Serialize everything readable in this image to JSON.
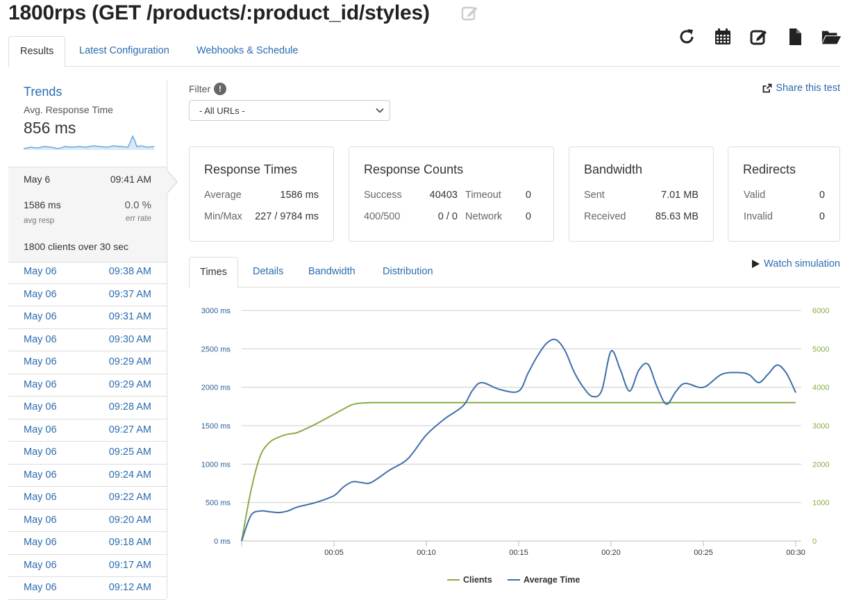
{
  "page": {
    "title": "1800rps (GET /products/:product_id/styles)"
  },
  "toolbar": {
    "icons": [
      "refresh-icon",
      "calendar-icon",
      "edit-icon",
      "file-icon",
      "folder-open-icon"
    ]
  },
  "top_tabs": [
    {
      "label": "Results",
      "active": true
    },
    {
      "label": "Latest Configuration",
      "active": false
    },
    {
      "label": "Webhooks & Schedule",
      "active": false
    }
  ],
  "trends": {
    "title": "Trends",
    "subtitle": "Avg. Response Time",
    "value": "856 ms"
  },
  "current_run": {
    "date": "May 6",
    "time": "09:41 AM",
    "avg_resp": "1586 ms",
    "avg_resp_label": "avg resp",
    "err_rate": "0.0 %",
    "err_rate_label": "err rate",
    "clients_text_a": "1800",
    "clients_text_b": " clients over ",
    "clients_text_c": "30",
    "clients_text_d": " sec"
  },
  "history": [
    {
      "date": "May 06",
      "time": "09:38 AM"
    },
    {
      "date": "May 06",
      "time": "09:37 AM"
    },
    {
      "date": "May 06",
      "time": "09:31 AM"
    },
    {
      "date": "May 06",
      "time": "09:30 AM"
    },
    {
      "date": "May 06",
      "time": "09:29 AM"
    },
    {
      "date": "May 06",
      "time": "09:29 AM"
    },
    {
      "date": "May 06",
      "time": "09:28 AM"
    },
    {
      "date": "May 06",
      "time": "09:27 AM"
    },
    {
      "date": "May 06",
      "time": "09:25 AM"
    },
    {
      "date": "May 06",
      "time": "09:24 AM"
    },
    {
      "date": "May 06",
      "time": "09:22 AM"
    },
    {
      "date": "May 06",
      "time": "09:20 AM"
    },
    {
      "date": "May 06",
      "time": "09:18 AM"
    },
    {
      "date": "May 06",
      "time": "09:17 AM"
    },
    {
      "date": "May 06",
      "time": "09:12 AM"
    }
  ],
  "filter": {
    "label": "Filter",
    "info": "!",
    "selected": "- All URLs -"
  },
  "share_label": "Share this test",
  "cards": {
    "response_times": {
      "title": "Response Times",
      "average_label": "Average",
      "average": "1586 ms",
      "minmax_label": "Min/Max",
      "minmax": "227 / 9784 ms"
    },
    "response_counts": {
      "title": "Response Counts",
      "success_label": "Success",
      "success": "40403",
      "timeout_label": "Timeout",
      "timeout": "0",
      "errors_label": "400/500",
      "errors": "0 / 0",
      "network_label": "Network",
      "network": "0"
    },
    "bandwidth": {
      "title": "Bandwidth",
      "sent_label": "Sent",
      "sent": "7.01 MB",
      "received_label": "Received",
      "received": "85.63 MB"
    },
    "redirects": {
      "title": "Redirects",
      "valid_label": "Valid",
      "valid": "0",
      "invalid_label": "Invalid",
      "invalid": "0"
    }
  },
  "chart_tabs": [
    {
      "label": "Times",
      "active": true
    },
    {
      "label": "Details",
      "active": false
    },
    {
      "label": "Bandwidth",
      "active": false
    },
    {
      "label": "Distribution",
      "active": false
    }
  ],
  "watch_label": "Watch simulation",
  "colors": {
    "clients": "#8aab45",
    "avg_time": "#3e6ea8",
    "link": "#2a6cb0",
    "spark": "#6aa8de"
  },
  "chart_data": {
    "type": "line",
    "x_ticks": [
      "00:05",
      "00:10",
      "00:15",
      "00:20",
      "00:25",
      "00:30"
    ],
    "x_tick_seconds": [
      5,
      10,
      15,
      20,
      25,
      30
    ],
    "xlim": [
      0,
      30
    ],
    "y_left": {
      "ticks": [
        "0 ms",
        "500 ms",
        "1000 ms",
        "1500 ms",
        "2000 ms",
        "2500 ms",
        "3000 ms"
      ],
      "ylim": [
        0,
        3000
      ]
    },
    "y_right": {
      "ticks": [
        "0",
        "1000",
        "2000",
        "3000",
        "4000",
        "5000",
        "6000"
      ],
      "ylim": [
        0,
        6000
      ]
    },
    "grid": true,
    "legend_position": "bottom-center",
    "series": [
      {
        "name": "Clients",
        "axis": "right",
        "x": [
          0,
          0.5,
          1,
          1.5,
          2,
          2.5,
          3,
          4,
          5,
          5.5,
          6,
          6.5,
          7,
          8,
          10,
          12,
          14,
          16,
          18,
          20,
          22,
          24,
          26,
          28,
          30
        ],
        "values": [
          0,
          1300,
          2200,
          2560,
          2700,
          2780,
          2820,
          3040,
          3300,
          3430,
          3550,
          3590,
          3600,
          3600,
          3600,
          3600,
          3600,
          3600,
          3600,
          3600,
          3600,
          3600,
          3600,
          3600,
          3600
        ]
      },
      {
        "name": "Average Time",
        "axis": "left",
        "x": [
          0,
          0.5,
          1,
          1.5,
          2,
          2.5,
          3,
          4,
          5,
          5.5,
          6,
          6.5,
          7,
          8,
          9,
          10,
          11,
          12,
          12.5,
          13,
          14,
          15,
          15.5,
          16,
          16.5,
          17,
          17.5,
          18,
          18.5,
          19,
          19.5,
          20,
          20.5,
          21,
          21.5,
          22,
          22.5,
          23,
          23.5,
          24,
          25,
          26,
          27,
          27.5,
          28,
          28.5,
          29,
          29.5,
          30
        ],
        "values": [
          0,
          330,
          390,
          380,
          370,
          390,
          440,
          500,
          590,
          700,
          770,
          760,
          760,
          920,
          1070,
          1380,
          1590,
          1760,
          1960,
          2060,
          1970,
          1950,
          2180,
          2400,
          2570,
          2620,
          2480,
          2200,
          2000,
          1880,
          1960,
          2470,
          2230,
          1950,
          2220,
          2300,
          2000,
          1780,
          1940,
          2050,
          2000,
          2170,
          2190,
          2160,
          2060,
          2170,
          2290,
          2180,
          1930
        ]
      }
    ]
  }
}
